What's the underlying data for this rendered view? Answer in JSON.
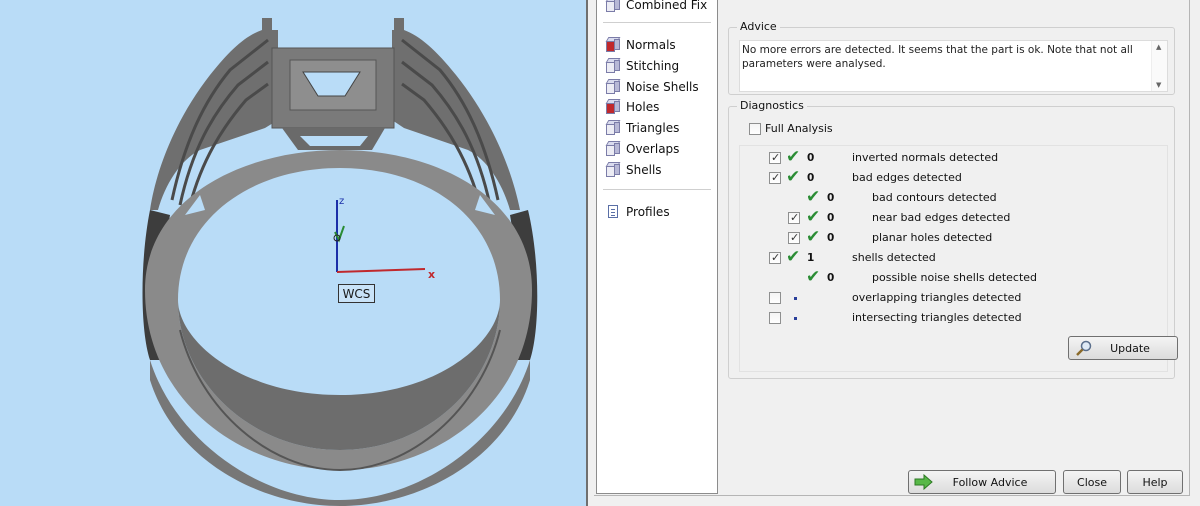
{
  "viewport": {
    "axis_z_label": "z",
    "axis_x_label": "x",
    "wcs_label": "WCS"
  },
  "nav": {
    "top_item": "Combined Fix",
    "items": [
      {
        "label": "Normals",
        "icon": "normals-cube-icon"
      },
      {
        "label": "Stitching",
        "icon": "stitching-cube-icon"
      },
      {
        "label": "Noise Shells",
        "icon": "noise-shells-cube-icon"
      },
      {
        "label": "Holes",
        "icon": "holes-cube-icon"
      },
      {
        "label": "Triangles",
        "icon": "triangles-cube-icon"
      },
      {
        "label": "Overlaps",
        "icon": "overlaps-cube-icon"
      },
      {
        "label": "Shells",
        "icon": "shells-cube-icon"
      }
    ],
    "profiles_label": "Profiles"
  },
  "advice": {
    "title": "Advice",
    "text": "No more errors are detected. It seems that the part is ok. Note that not all parameters were analysed."
  },
  "diagnostics": {
    "title": "Diagnostics",
    "full_analysis_label": "Full Analysis",
    "full_analysis_checked": false,
    "rows": [
      {
        "checked": true,
        "ok": true,
        "value": "0",
        "label": "inverted normals detected",
        "indent": 0
      },
      {
        "checked": true,
        "ok": true,
        "value": "0",
        "label": "bad edges detected",
        "indent": 0
      },
      {
        "checked": null,
        "ok": true,
        "value": "0",
        "label": "bad contours detected",
        "indent": 1
      },
      {
        "checked": true,
        "ok": true,
        "value": "0",
        "label": "near bad edges detected",
        "indent": 1
      },
      {
        "checked": true,
        "ok": true,
        "value": "0",
        "label": "planar holes detected",
        "indent": 1
      },
      {
        "checked": true,
        "ok": true,
        "value": "1",
        "label": "shells detected",
        "indent": 0
      },
      {
        "checked": null,
        "ok": true,
        "value": "0",
        "label": "possible noise shells detected",
        "indent": 1
      },
      {
        "checked": false,
        "ok": false,
        "value": "•",
        "label": "overlapping triangles detected",
        "indent": 0
      },
      {
        "checked": false,
        "ok": false,
        "value": "•",
        "label": "intersecting triangles detected",
        "indent": 0
      }
    ],
    "update_label": "Update"
  },
  "footer": {
    "follow_advice_label": "Follow Advice",
    "close_label": "Close",
    "help_label": "Help"
  },
  "colors": {
    "viewport_bg": "#b9dcf7",
    "ring": "#8a8a8a",
    "check_green": "#2a8c34"
  }
}
